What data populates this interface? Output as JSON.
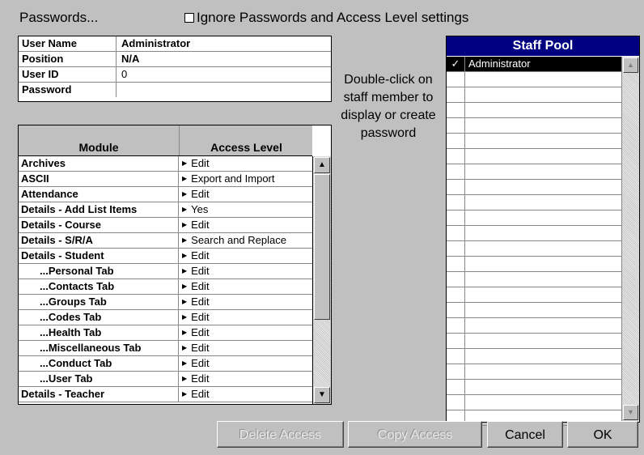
{
  "title": "Passwords...",
  "ignore_checkbox": {
    "label": "Ignore Passwords and Access Level settings",
    "checked": false
  },
  "user": [
    {
      "key": "User Name",
      "value": "Administrator"
    },
    {
      "key": "Position",
      "value": "N/A"
    },
    {
      "key": "User ID",
      "value": "0"
    },
    {
      "key": "Password",
      "value": ""
    }
  ],
  "hint": "Double-click on staff member to display or create password",
  "module_grid": {
    "columns": [
      "Module",
      "Access Level"
    ],
    "rows": [
      {
        "module": "Archives",
        "access": "Edit"
      },
      {
        "module": "ASCII",
        "access": "Export and Import"
      },
      {
        "module": "Attendance",
        "access": "Edit"
      },
      {
        "module": "Details - Add List Items",
        "access": "Yes"
      },
      {
        "module": "Details - Course",
        "access": "Edit"
      },
      {
        "module": "Details - S/R/A",
        "access": "Search and Replace"
      },
      {
        "module": "Details - Student",
        "access": "Edit"
      },
      {
        "module": "...Personal Tab",
        "access": "Edit"
      },
      {
        "module": "...Contacts Tab",
        "access": "Edit"
      },
      {
        "module": "...Groups Tab",
        "access": "Edit"
      },
      {
        "module": "...Codes Tab",
        "access": "Edit"
      },
      {
        "module": "...Health Tab",
        "access": "Edit"
      },
      {
        "module": "...Miscellaneous Tab",
        "access": "Edit"
      },
      {
        "module": "...Conduct Tab",
        "access": "Edit"
      },
      {
        "module": "...User Tab",
        "access": "Edit"
      },
      {
        "module": "Details - Teacher",
        "access": "Edit"
      }
    ]
  },
  "staff_pool": {
    "title": "Staff Pool",
    "members": [
      {
        "check": "✓",
        "name": "Administrator"
      }
    ],
    "empty_rows": 23
  },
  "buttons": {
    "delete": "Delete Access",
    "copy": "Copy Access",
    "cancel": "Cancel",
    "ok": "OK"
  },
  "colors": {
    "pool_header": "#000080",
    "background": "#c0c0c0"
  }
}
